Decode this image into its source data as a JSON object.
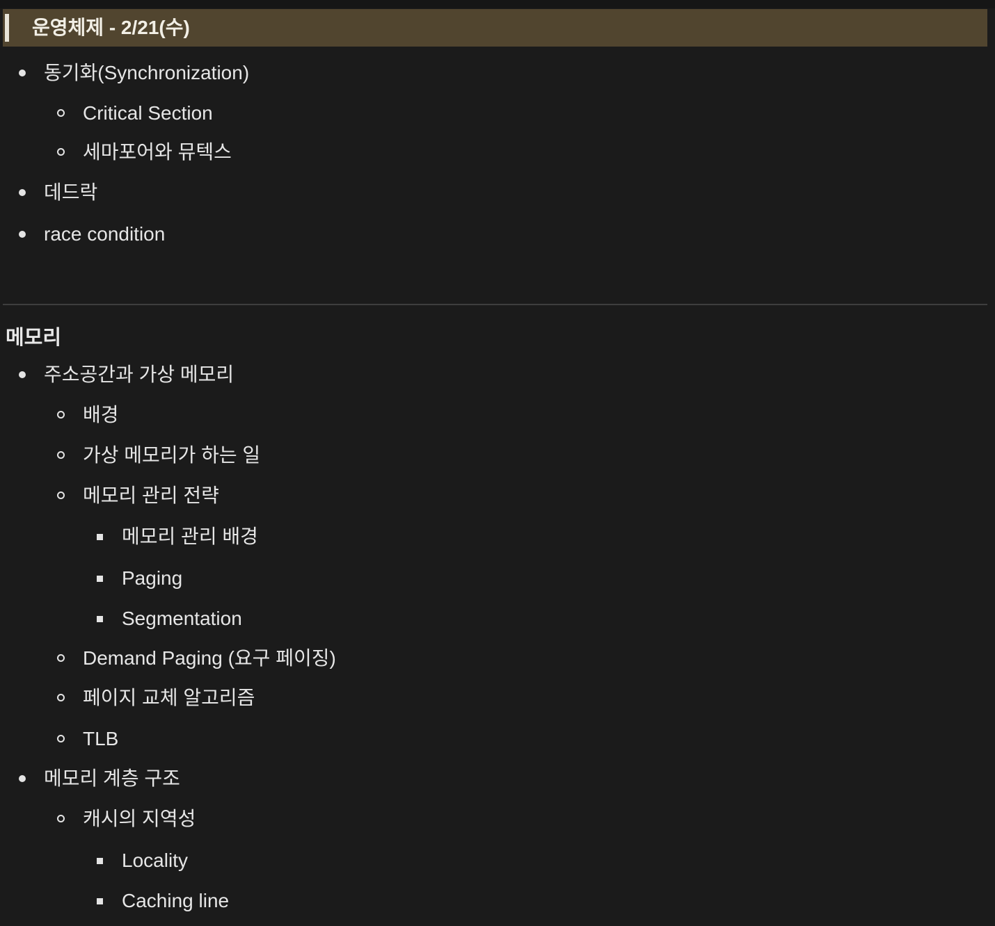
{
  "callout": {
    "title": "운영체제 - 2/21(수)"
  },
  "section1": {
    "items": [
      {
        "level": 1,
        "text": "동기화(Synchronization)"
      },
      {
        "level": 2,
        "text": "Critical Section"
      },
      {
        "level": 2,
        "text": "세마포어와 뮤텍스"
      },
      {
        "level": 1,
        "text": "데드락"
      },
      {
        "level": 1,
        "text": "race condition"
      }
    ]
  },
  "section2": {
    "heading": "메모리",
    "items": [
      {
        "level": 1,
        "text": "주소공간과 가상 메모리"
      },
      {
        "level": 2,
        "text": "배경"
      },
      {
        "level": 2,
        "text": "가상 메모리가 하는 일"
      },
      {
        "level": 2,
        "text": "메모리 관리 전략"
      },
      {
        "level": 3,
        "text": "메모리 관리 배경"
      },
      {
        "level": 3,
        "text": "Paging"
      },
      {
        "level": 3,
        "text": "Segmentation"
      },
      {
        "level": 2,
        "text": "Demand Paging (요구 페이징)"
      },
      {
        "level": 2,
        "text": "페이지 교체 알고리즘"
      },
      {
        "level": 2,
        "text": "TLB"
      },
      {
        "level": 1,
        "text": "메모리 계층 구조"
      },
      {
        "level": 2,
        "text": "캐시의 지역성"
      },
      {
        "level": 3,
        "text": "Locality"
      },
      {
        "level": 3,
        "text": "Caching line"
      }
    ]
  },
  "colors": {
    "background": "#1b1b1b",
    "callout_background": "#51452f",
    "text": "#e6e6e6",
    "divider": "#3e3e3e"
  }
}
